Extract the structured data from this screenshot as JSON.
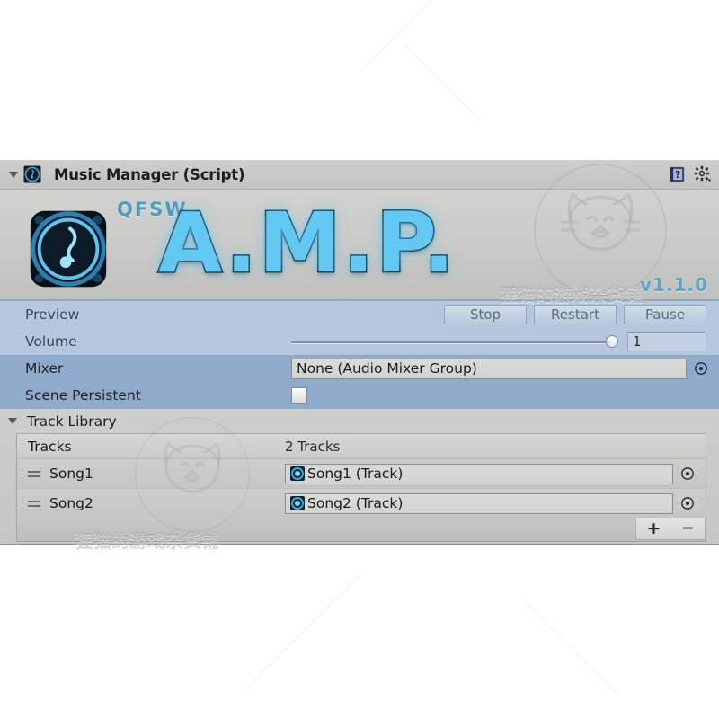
{
  "component": {
    "title": "Music Manager (Script)",
    "foldout_open": true,
    "script_icon": "amp-speaker-icon",
    "help_icon": "help-book-icon",
    "gear_icon": "gear-icon"
  },
  "banner": {
    "brand": "QFSW",
    "product": "A.M.P.",
    "version": "v1.1.0",
    "logo_icon": "amp-speaker-logo"
  },
  "preview": {
    "label": "Preview",
    "buttons": [
      {
        "label": "Stop",
        "name": "stop-button"
      },
      {
        "label": "Restart",
        "name": "restart-button"
      },
      {
        "label": "Pause",
        "name": "pause-button"
      }
    ]
  },
  "volume": {
    "label": "Volume",
    "value": "1",
    "slider_percent": 100
  },
  "mixer": {
    "label": "Mixer",
    "value": "None (Audio Mixer Group)",
    "picker_icon": "object-picker-icon"
  },
  "scene_persistent": {
    "label": "Scene Persistent",
    "checked": false
  },
  "track_library": {
    "title": "Track Library",
    "foldout_open": true,
    "list_header_label": "Tracks",
    "list_count_label": "2 Tracks",
    "add_label": "+",
    "remove_label": "−",
    "tracks": [
      {
        "name": "Song1",
        "value": "Song1 (Track)"
      },
      {
        "name": "Song2",
        "value": "Song2 (Track)"
      }
    ]
  },
  "watermark": {
    "text": "狸猫的游戏杂货铺",
    "icon": "cat-face-watermark-icon"
  },
  "colors": {
    "panel_gray": "#c9c9c7",
    "row_light_blue": "#b6c7dd",
    "row_dark_blue": "#8faacb",
    "accent_cyan": "#63c8f2",
    "brand_blue": "#4d9bbd"
  }
}
